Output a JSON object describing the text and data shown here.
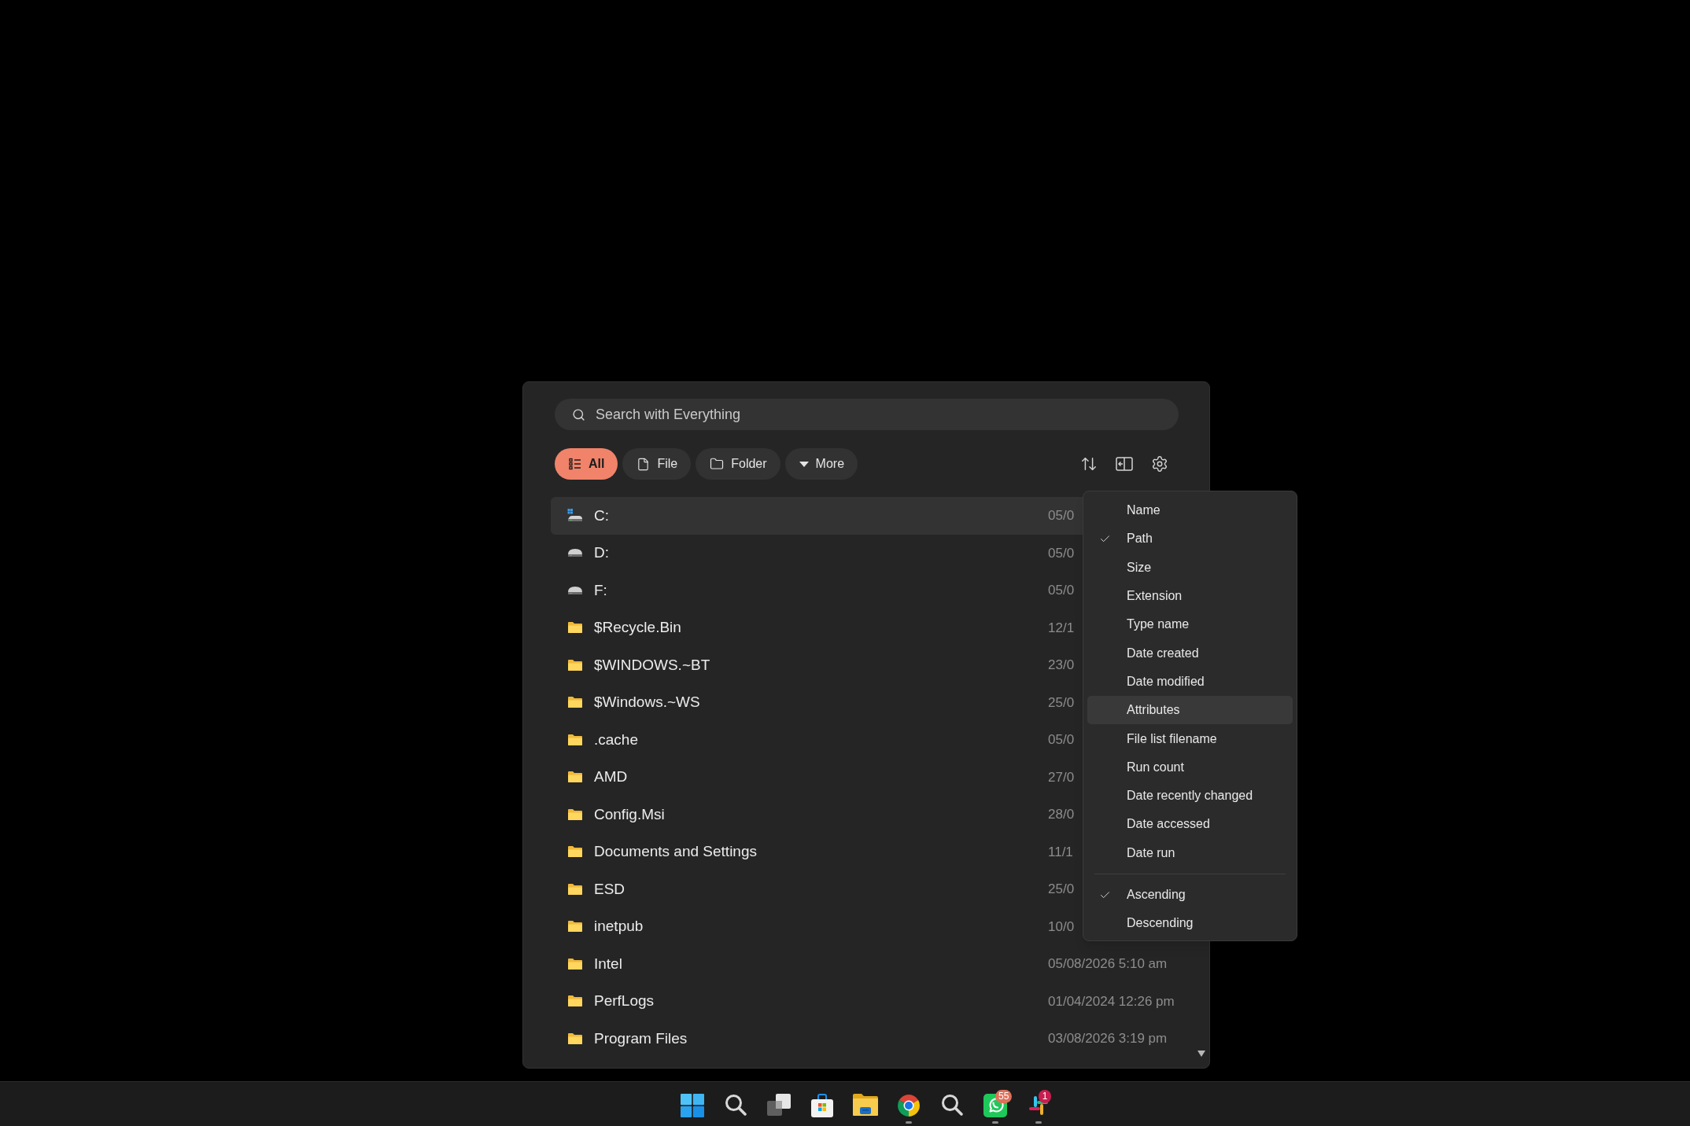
{
  "search": {
    "placeholder": "Search with Everything"
  },
  "filters": [
    {
      "kind": "list",
      "label": "All",
      "selected": true
    },
    {
      "kind": "file",
      "label": "File",
      "selected": false
    },
    {
      "kind": "folder",
      "label": "Folder",
      "selected": false
    },
    {
      "kind": "dropdown",
      "label": "More",
      "selected": false
    }
  ],
  "results": [
    {
      "kind": "system_drive",
      "name": "C:",
      "date": "05/0",
      "selected": true
    },
    {
      "kind": "drive",
      "name": "D:",
      "date": "05/0",
      "selected": false
    },
    {
      "kind": "drive",
      "name": "F:",
      "date": "05/0",
      "selected": false
    },
    {
      "kind": "folder",
      "name": "$Recycle.Bin",
      "date": "12/1",
      "selected": false
    },
    {
      "kind": "folder",
      "name": "$WINDOWS.~BT",
      "date": "23/0",
      "selected": false
    },
    {
      "kind": "folder",
      "name": "$Windows.~WS",
      "date": "25/0",
      "selected": false
    },
    {
      "kind": "folder",
      "name": ".cache",
      "date": "05/0",
      "selected": false
    },
    {
      "kind": "folder",
      "name": "AMD",
      "date": "27/0",
      "selected": false
    },
    {
      "kind": "folder",
      "name": "Config.Msi",
      "date": "28/0",
      "selected": false
    },
    {
      "kind": "folder",
      "name": "Documents and Settings",
      "date": "11/1",
      "selected": false
    },
    {
      "kind": "folder",
      "name": "ESD",
      "date": "25/0",
      "selected": false
    },
    {
      "kind": "folder",
      "name": "inetpub",
      "date": "10/0",
      "selected": false
    },
    {
      "kind": "folder",
      "name": "Intel",
      "date": "05/08/2026 5:10 am",
      "selected": false
    },
    {
      "kind": "folder",
      "name": "PerfLogs",
      "date": "01/04/2024 12:26 pm",
      "selected": false
    },
    {
      "kind": "folder",
      "name": "Program Files",
      "date": "03/08/2026 3:19 pm",
      "selected": false
    }
  ],
  "sort_menu": {
    "fields": [
      {
        "label": "Name",
        "checked": false,
        "highlighted": false
      },
      {
        "label": "Path",
        "checked": true,
        "highlighted": false
      },
      {
        "label": "Size",
        "checked": false,
        "highlighted": false
      },
      {
        "label": "Extension",
        "checked": false,
        "highlighted": false
      },
      {
        "label": "Type name",
        "checked": false,
        "highlighted": false
      },
      {
        "label": "Date created",
        "checked": false,
        "highlighted": false
      },
      {
        "label": "Date modified",
        "checked": false,
        "highlighted": false
      },
      {
        "label": "Attributes",
        "checked": false,
        "highlighted": true
      },
      {
        "label": "File list filename",
        "checked": false,
        "highlighted": false
      },
      {
        "label": "Run count",
        "checked": false,
        "highlighted": false
      },
      {
        "label": "Date recently changed",
        "checked": false,
        "highlighted": false
      },
      {
        "label": "Date accessed",
        "checked": false,
        "highlighted": false
      },
      {
        "label": "Date run",
        "checked": false,
        "highlighted": false
      }
    ],
    "order": [
      {
        "label": "Ascending",
        "checked": true,
        "highlighted": false
      },
      {
        "label": "Descending",
        "checked": false,
        "highlighted": false
      }
    ]
  },
  "taskbar": {
    "items": [
      {
        "kind": "start",
        "running": false
      },
      {
        "kind": "search",
        "running": false
      },
      {
        "kind": "taskview",
        "running": false
      },
      {
        "kind": "store",
        "running": false
      },
      {
        "kind": "explorer",
        "running": false
      },
      {
        "kind": "browser",
        "running": true
      },
      {
        "kind": "search",
        "running": false
      },
      {
        "kind": "chat",
        "running": true,
        "badge": {
          "text": "55",
          "color": "#e0705a"
        }
      },
      {
        "kind": "workspace",
        "running": true,
        "badge": {
          "text": "1",
          "color": "#c81d50"
        }
      }
    ]
  }
}
